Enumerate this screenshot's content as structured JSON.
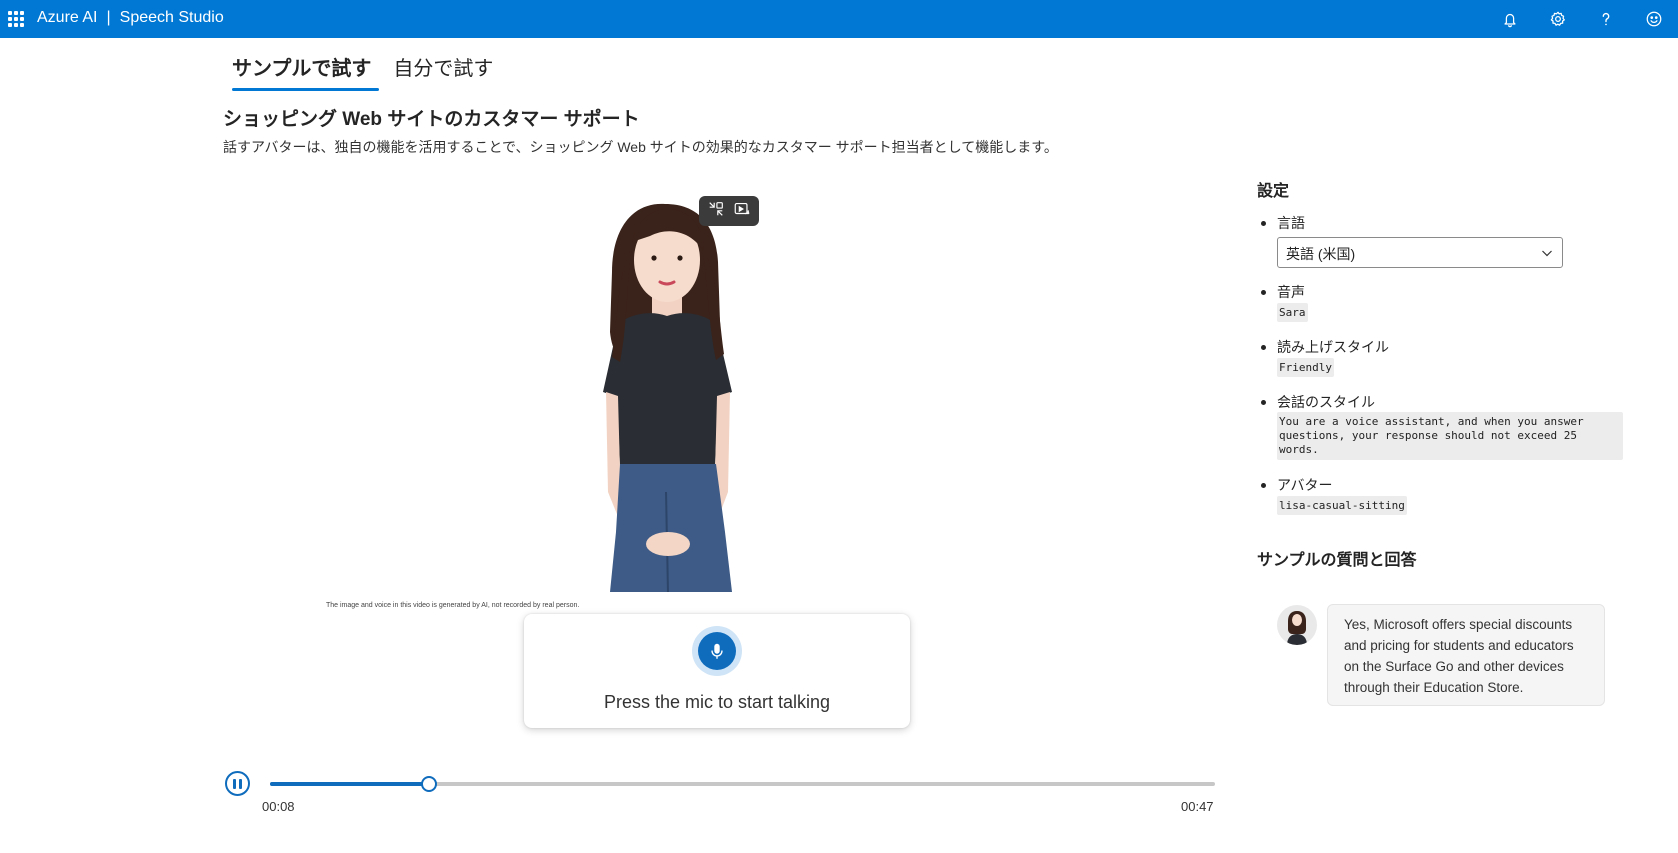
{
  "header": {
    "brand": "Azure AI",
    "separator": "|",
    "product": "Speech Studio"
  },
  "tabs": [
    {
      "label": "サンプルで試す",
      "active": true
    },
    {
      "label": "自分で試す",
      "active": false
    }
  ],
  "main": {
    "title": "ショッピング Web サイトのカスタマー サポート",
    "description": "話すアバターは、独自の機能を活用することで、ショッピング Web サイトの効果的なカスタマー サポート担当者として機能します。",
    "disclaimer": "The image and voice in this video is generated by AI, not recorded by real person.",
    "mic_prompt": "Press the mic to start talking"
  },
  "player": {
    "current_time": "00:08",
    "duration": "00:47",
    "progress": 0.168
  },
  "settings": {
    "heading": "設定",
    "language_label": "言語",
    "language_value": "英語 (米国)",
    "voice_label": "音声",
    "voice_value": "Sara",
    "style_label": "読み上げスタイル",
    "style_value": "Friendly",
    "conversation_label": "会話のスタイル",
    "conversation_value": "You are a voice assistant, and when you answer questions, your response should not exceed 25 words.",
    "avatar_label": "アバター",
    "avatar_value": "lisa-casual-sitting"
  },
  "qa": {
    "heading": "サンプルの質問と回答",
    "answer": "Yes, Microsoft offers special discounts and pricing for students and educators on the Surface Go and other devices through their Education Store."
  },
  "colors": {
    "accent": "#0078d4",
    "button": "#0f6cbd"
  },
  "icons": [
    "apps-grid-icon",
    "bell-icon",
    "gear-icon",
    "help-icon",
    "feedback-smiley-icon",
    "exit-fullscreen-icon",
    "picture-in-picture-icon",
    "mic-icon",
    "pause-icon",
    "chevron-down-icon"
  ]
}
